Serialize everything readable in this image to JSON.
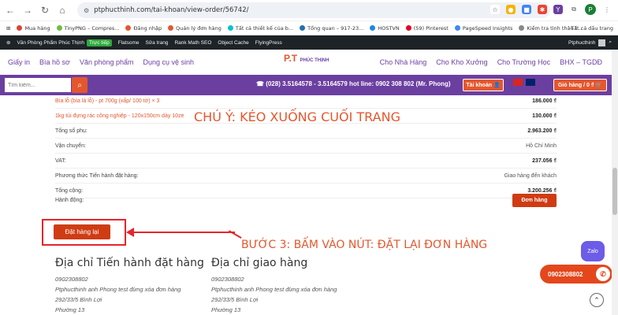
{
  "browser": {
    "url": "ptphucthinh.com/tai-khoan/view-order/56742/",
    "profile_initial": "P"
  },
  "bookmarks": [
    {
      "label": "Mua hàng",
      "color": "#db4437"
    },
    {
      "label": "TinyPNG – Compres...",
      "color": "#6fbd45"
    },
    {
      "label": "Đăng nhập",
      "color": "#e4572e"
    },
    {
      "label": "Quản lý đơn hàng",
      "color": "#e4572e"
    },
    {
      "label": "Tất cả thiết kế của b...",
      "color": "#00c4cc"
    },
    {
      "label": "Tổng quan – 917-23...",
      "color": "#2271b1"
    },
    {
      "label": "HOSTVN",
      "color": "#1e88e5"
    },
    {
      "label": "(59) Pinterest",
      "color": "#e60023"
    },
    {
      "label": "PageSpeed Insights",
      "color": "#4285f4"
    },
    {
      "label": "Kiểm tra tình thân t...",
      "color": "#888"
    }
  ],
  "bookmarks_right": "Tất cả dấu trang",
  "wpbar": {
    "site": "Văn Phòng Phẩm Phúc Thịnh",
    "live": "Trực tiếp",
    "items": [
      "Flatsome",
      "Sửa trang",
      "Rank Math SEO",
      "Object Cache",
      "FlyingPress"
    ],
    "user": "Ptphucthinh"
  },
  "sitenav": {
    "left": [
      "Giấy in",
      "Bìa hồ sơ",
      "Văn phòng phẩm",
      "Dụng cụ vệ sinh"
    ],
    "right": [
      "Cho Nhà Hàng",
      "Cho Kho Xưởng",
      "Cho Trường Học",
      "BHX – TGDĐ"
    ],
    "logo": "P.T",
    "logo_sub": "PHÚC THỊNH"
  },
  "searchbar": {
    "placeholder": "Tìm kiếm...",
    "hotline": "☎ (028) 3.5164578 - 3.5164579 hot line: 0902 308 802 (Mr. Phong)",
    "account": "Tài khoản",
    "cart": "Giỏ hàng / 0 ₫"
  },
  "order_rows": [
    {
      "label": "Bìa lỗ (bìa lá lỗ) - pt 700g (xấp/ 100 tờ) × 3",
      "value": "186.000 ₫",
      "orange": true,
      "bold": true
    },
    {
      "label": "1kg túi đựng rác công nghiệp - 120x150cm dày 10ze",
      "value": "130.000 ₫",
      "orange": true,
      "bold": true
    },
    {
      "label": "Tổng số phụ:",
      "value": "2.963.200 ₫",
      "orange": false,
      "bold": true
    },
    {
      "label": "Vận chuyển:",
      "value": "Hồ Chí Minh",
      "orange": false,
      "bold": false
    },
    {
      "label": "VAT:",
      "value": "237.056 ₫",
      "orange": false,
      "bold": true
    },
    {
      "label": "Phương thức Tiến hành đặt hàng:",
      "value": "Giao hàng đến khách",
      "orange": false,
      "bold": false
    },
    {
      "label": "Tổng cộng:",
      "value": "3.200.256 ₫",
      "orange": false,
      "bold": true
    }
  ],
  "actions_label": "Hành động:",
  "order_button": "Đơn hàng",
  "note_top": "CHÚ Ý: KÉO XUỐNG CUỐI TRANG",
  "note_step": "BƯỚC 3: BẤM VÀO NÚT: ĐẶT LẠI ĐƠN HÀNG",
  "reorder_button": "Đặt hàng lại",
  "billing": {
    "title": "Địa chỉ Tiến hành đặt hàng",
    "lines": [
      "0902308802",
      "Ptphucthinh anh Phong test đừng xóa đơn hàng",
      "292/33/5 Bình Lợi",
      "Phường 13"
    ]
  },
  "shipping": {
    "title": "Địa chỉ giao hàng",
    "lines": [
      "0902308802",
      "Ptphucthinh anh Phong test đừng xóa đơn hàng",
      "292/33/5 Bình Lợi",
      "Phường 13"
    ]
  },
  "zalo": "Zalo",
  "phone_pill": "0902308802",
  "colors": {
    "accent": "#6b3fa0",
    "orange": "#e4572e",
    "red": "#e4262b"
  }
}
